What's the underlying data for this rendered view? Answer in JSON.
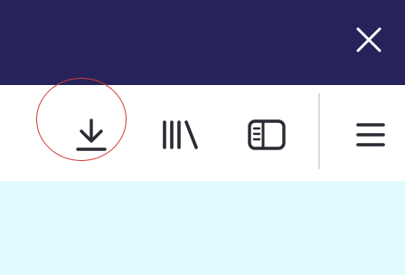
{
  "titlebar": {
    "close_icon": "close-icon",
    "background": "#25235a"
  },
  "toolbar": {
    "buttons": [
      {
        "id": "downloads",
        "icon": "download-icon",
        "highlighted": true
      },
      {
        "id": "library",
        "icon": "library-icon"
      },
      {
        "id": "sidebar",
        "icon": "sidebar-icon"
      },
      {
        "id": "menu",
        "icon": "hamburger-menu-icon"
      }
    ],
    "icon_color": "#2b2a33",
    "highlight_color": "#d43a3a"
  },
  "content": {
    "background": "#e0fbfd"
  }
}
